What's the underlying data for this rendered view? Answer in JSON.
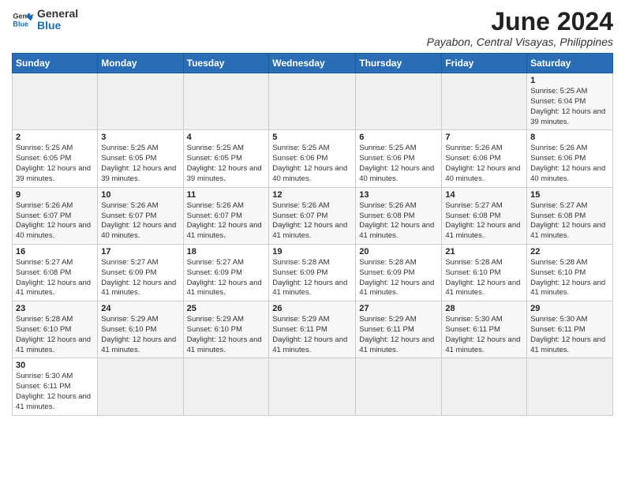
{
  "logo": {
    "text_general": "General",
    "text_blue": "Blue"
  },
  "title": "June 2024",
  "subtitle": "Payabon, Central Visayas, Philippines",
  "weekdays": [
    "Sunday",
    "Monday",
    "Tuesday",
    "Wednesday",
    "Thursday",
    "Friday",
    "Saturday"
  ],
  "weeks": [
    [
      {
        "day": "",
        "sunrise": "",
        "sunset": "",
        "daylight": ""
      },
      {
        "day": "",
        "sunrise": "",
        "sunset": "",
        "daylight": ""
      },
      {
        "day": "",
        "sunrise": "",
        "sunset": "",
        "daylight": ""
      },
      {
        "day": "",
        "sunrise": "",
        "sunset": "",
        "daylight": ""
      },
      {
        "day": "",
        "sunrise": "",
        "sunset": "",
        "daylight": ""
      },
      {
        "day": "",
        "sunrise": "",
        "sunset": "",
        "daylight": ""
      },
      {
        "day": "1",
        "sunrise": "Sunrise: 5:25 AM",
        "sunset": "Sunset: 6:04 PM",
        "daylight": "Daylight: 12 hours and 39 minutes."
      }
    ],
    [
      {
        "day": "2",
        "sunrise": "Sunrise: 5:25 AM",
        "sunset": "Sunset: 6:05 PM",
        "daylight": "Daylight: 12 hours and 39 minutes."
      },
      {
        "day": "3",
        "sunrise": "Sunrise: 5:25 AM",
        "sunset": "Sunset: 6:05 PM",
        "daylight": "Daylight: 12 hours and 39 minutes."
      },
      {
        "day": "4",
        "sunrise": "Sunrise: 5:25 AM",
        "sunset": "Sunset: 6:05 PM",
        "daylight": "Daylight: 12 hours and 39 minutes."
      },
      {
        "day": "5",
        "sunrise": "Sunrise: 5:25 AM",
        "sunset": "Sunset: 6:06 PM",
        "daylight": "Daylight: 12 hours and 40 minutes."
      },
      {
        "day": "6",
        "sunrise": "Sunrise: 5:25 AM",
        "sunset": "Sunset: 6:06 PM",
        "daylight": "Daylight: 12 hours and 40 minutes."
      },
      {
        "day": "7",
        "sunrise": "Sunrise: 5:26 AM",
        "sunset": "Sunset: 6:06 PM",
        "daylight": "Daylight: 12 hours and 40 minutes."
      },
      {
        "day": "8",
        "sunrise": "Sunrise: 5:26 AM",
        "sunset": "Sunset: 6:06 PM",
        "daylight": "Daylight: 12 hours and 40 minutes."
      }
    ],
    [
      {
        "day": "9",
        "sunrise": "Sunrise: 5:26 AM",
        "sunset": "Sunset: 6:07 PM",
        "daylight": "Daylight: 12 hours and 40 minutes."
      },
      {
        "day": "10",
        "sunrise": "Sunrise: 5:26 AM",
        "sunset": "Sunset: 6:07 PM",
        "daylight": "Daylight: 12 hours and 40 minutes."
      },
      {
        "day": "11",
        "sunrise": "Sunrise: 5:26 AM",
        "sunset": "Sunset: 6:07 PM",
        "daylight": "Daylight: 12 hours and 41 minutes."
      },
      {
        "day": "12",
        "sunrise": "Sunrise: 5:26 AM",
        "sunset": "Sunset: 6:07 PM",
        "daylight": "Daylight: 12 hours and 41 minutes."
      },
      {
        "day": "13",
        "sunrise": "Sunrise: 5:26 AM",
        "sunset": "Sunset: 6:08 PM",
        "daylight": "Daylight: 12 hours and 41 minutes."
      },
      {
        "day": "14",
        "sunrise": "Sunrise: 5:27 AM",
        "sunset": "Sunset: 6:08 PM",
        "daylight": "Daylight: 12 hours and 41 minutes."
      },
      {
        "day": "15",
        "sunrise": "Sunrise: 5:27 AM",
        "sunset": "Sunset: 6:08 PM",
        "daylight": "Daylight: 12 hours and 41 minutes."
      }
    ],
    [
      {
        "day": "16",
        "sunrise": "Sunrise: 5:27 AM",
        "sunset": "Sunset: 6:08 PM",
        "daylight": "Daylight: 12 hours and 41 minutes."
      },
      {
        "day": "17",
        "sunrise": "Sunrise: 5:27 AM",
        "sunset": "Sunset: 6:09 PM",
        "daylight": "Daylight: 12 hours and 41 minutes."
      },
      {
        "day": "18",
        "sunrise": "Sunrise: 5:27 AM",
        "sunset": "Sunset: 6:09 PM",
        "daylight": "Daylight: 12 hours and 41 minutes."
      },
      {
        "day": "19",
        "sunrise": "Sunrise: 5:28 AM",
        "sunset": "Sunset: 6:09 PM",
        "daylight": "Daylight: 12 hours and 41 minutes."
      },
      {
        "day": "20",
        "sunrise": "Sunrise: 5:28 AM",
        "sunset": "Sunset: 6:09 PM",
        "daylight": "Daylight: 12 hours and 41 minutes."
      },
      {
        "day": "21",
        "sunrise": "Sunrise: 5:28 AM",
        "sunset": "Sunset: 6:10 PM",
        "daylight": "Daylight: 12 hours and 41 minutes."
      },
      {
        "day": "22",
        "sunrise": "Sunrise: 5:28 AM",
        "sunset": "Sunset: 6:10 PM",
        "daylight": "Daylight: 12 hours and 41 minutes."
      }
    ],
    [
      {
        "day": "23",
        "sunrise": "Sunrise: 5:28 AM",
        "sunset": "Sunset: 6:10 PM",
        "daylight": "Daylight: 12 hours and 41 minutes."
      },
      {
        "day": "24",
        "sunrise": "Sunrise: 5:29 AM",
        "sunset": "Sunset: 6:10 PM",
        "daylight": "Daylight: 12 hours and 41 minutes."
      },
      {
        "day": "25",
        "sunrise": "Sunrise: 5:29 AM",
        "sunset": "Sunset: 6:10 PM",
        "daylight": "Daylight: 12 hours and 41 minutes."
      },
      {
        "day": "26",
        "sunrise": "Sunrise: 5:29 AM",
        "sunset": "Sunset: 6:11 PM",
        "daylight": "Daylight: 12 hours and 41 minutes."
      },
      {
        "day": "27",
        "sunrise": "Sunrise: 5:29 AM",
        "sunset": "Sunset: 6:11 PM",
        "daylight": "Daylight: 12 hours and 41 minutes."
      },
      {
        "day": "28",
        "sunrise": "Sunrise: 5:30 AM",
        "sunset": "Sunset: 6:11 PM",
        "daylight": "Daylight: 12 hours and 41 minutes."
      },
      {
        "day": "29",
        "sunrise": "Sunrise: 5:30 AM",
        "sunset": "Sunset: 6:11 PM",
        "daylight": "Daylight: 12 hours and 41 minutes."
      }
    ],
    [
      {
        "day": "30",
        "sunrise": "Sunrise: 5:30 AM",
        "sunset": "Sunset: 6:11 PM",
        "daylight": "Daylight: 12 hours and 41 minutes."
      },
      {
        "day": "",
        "sunrise": "",
        "sunset": "",
        "daylight": ""
      },
      {
        "day": "",
        "sunrise": "",
        "sunset": "",
        "daylight": ""
      },
      {
        "day": "",
        "sunrise": "",
        "sunset": "",
        "daylight": ""
      },
      {
        "day": "",
        "sunrise": "",
        "sunset": "",
        "daylight": ""
      },
      {
        "day": "",
        "sunrise": "",
        "sunset": "",
        "daylight": ""
      },
      {
        "day": "",
        "sunrise": "",
        "sunset": "",
        "daylight": ""
      }
    ]
  ]
}
